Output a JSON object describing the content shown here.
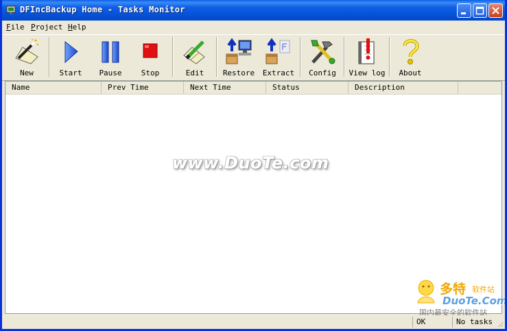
{
  "window": {
    "title": "DFIncBackup Home - Tasks Monitor"
  },
  "menu": [
    {
      "id": "file",
      "ul": "F",
      "rest": "ile"
    },
    {
      "id": "project",
      "ul": "P",
      "rest": "roject"
    },
    {
      "id": "help",
      "ul": "H",
      "rest": "elp"
    }
  ],
  "toolbar": {
    "new": "New",
    "start": "Start",
    "pause": "Pause",
    "stop": "Stop",
    "edit": "Edit",
    "restore": "Restore",
    "extract": "Extract",
    "config": "Config",
    "viewlog": "View log",
    "about": "About",
    "icons": [
      "wand-icon",
      "play-icon",
      "pause-icon",
      "stop-icon",
      "edit-icon",
      "restore-icon",
      "extract-icon",
      "config-icon",
      "view-log-icon",
      "help-icon"
    ]
  },
  "list": {
    "columns": [
      "Name",
      "Prev Time",
      "Next Time",
      "Status",
      "Description"
    ]
  },
  "status": {
    "left": "OK",
    "right": "No tasks"
  },
  "overlays": {
    "watermark": "www.DuoTe.com",
    "logo_brand": "多特",
    "logo_sub": "软件站",
    "logo_domain": "DuoTe.Com",
    "logo_slogan": "国内最安全的软件站"
  },
  "colors": {
    "titlebar": "#0553d9",
    "face": "#ece9d8",
    "border": "#0831d9"
  }
}
